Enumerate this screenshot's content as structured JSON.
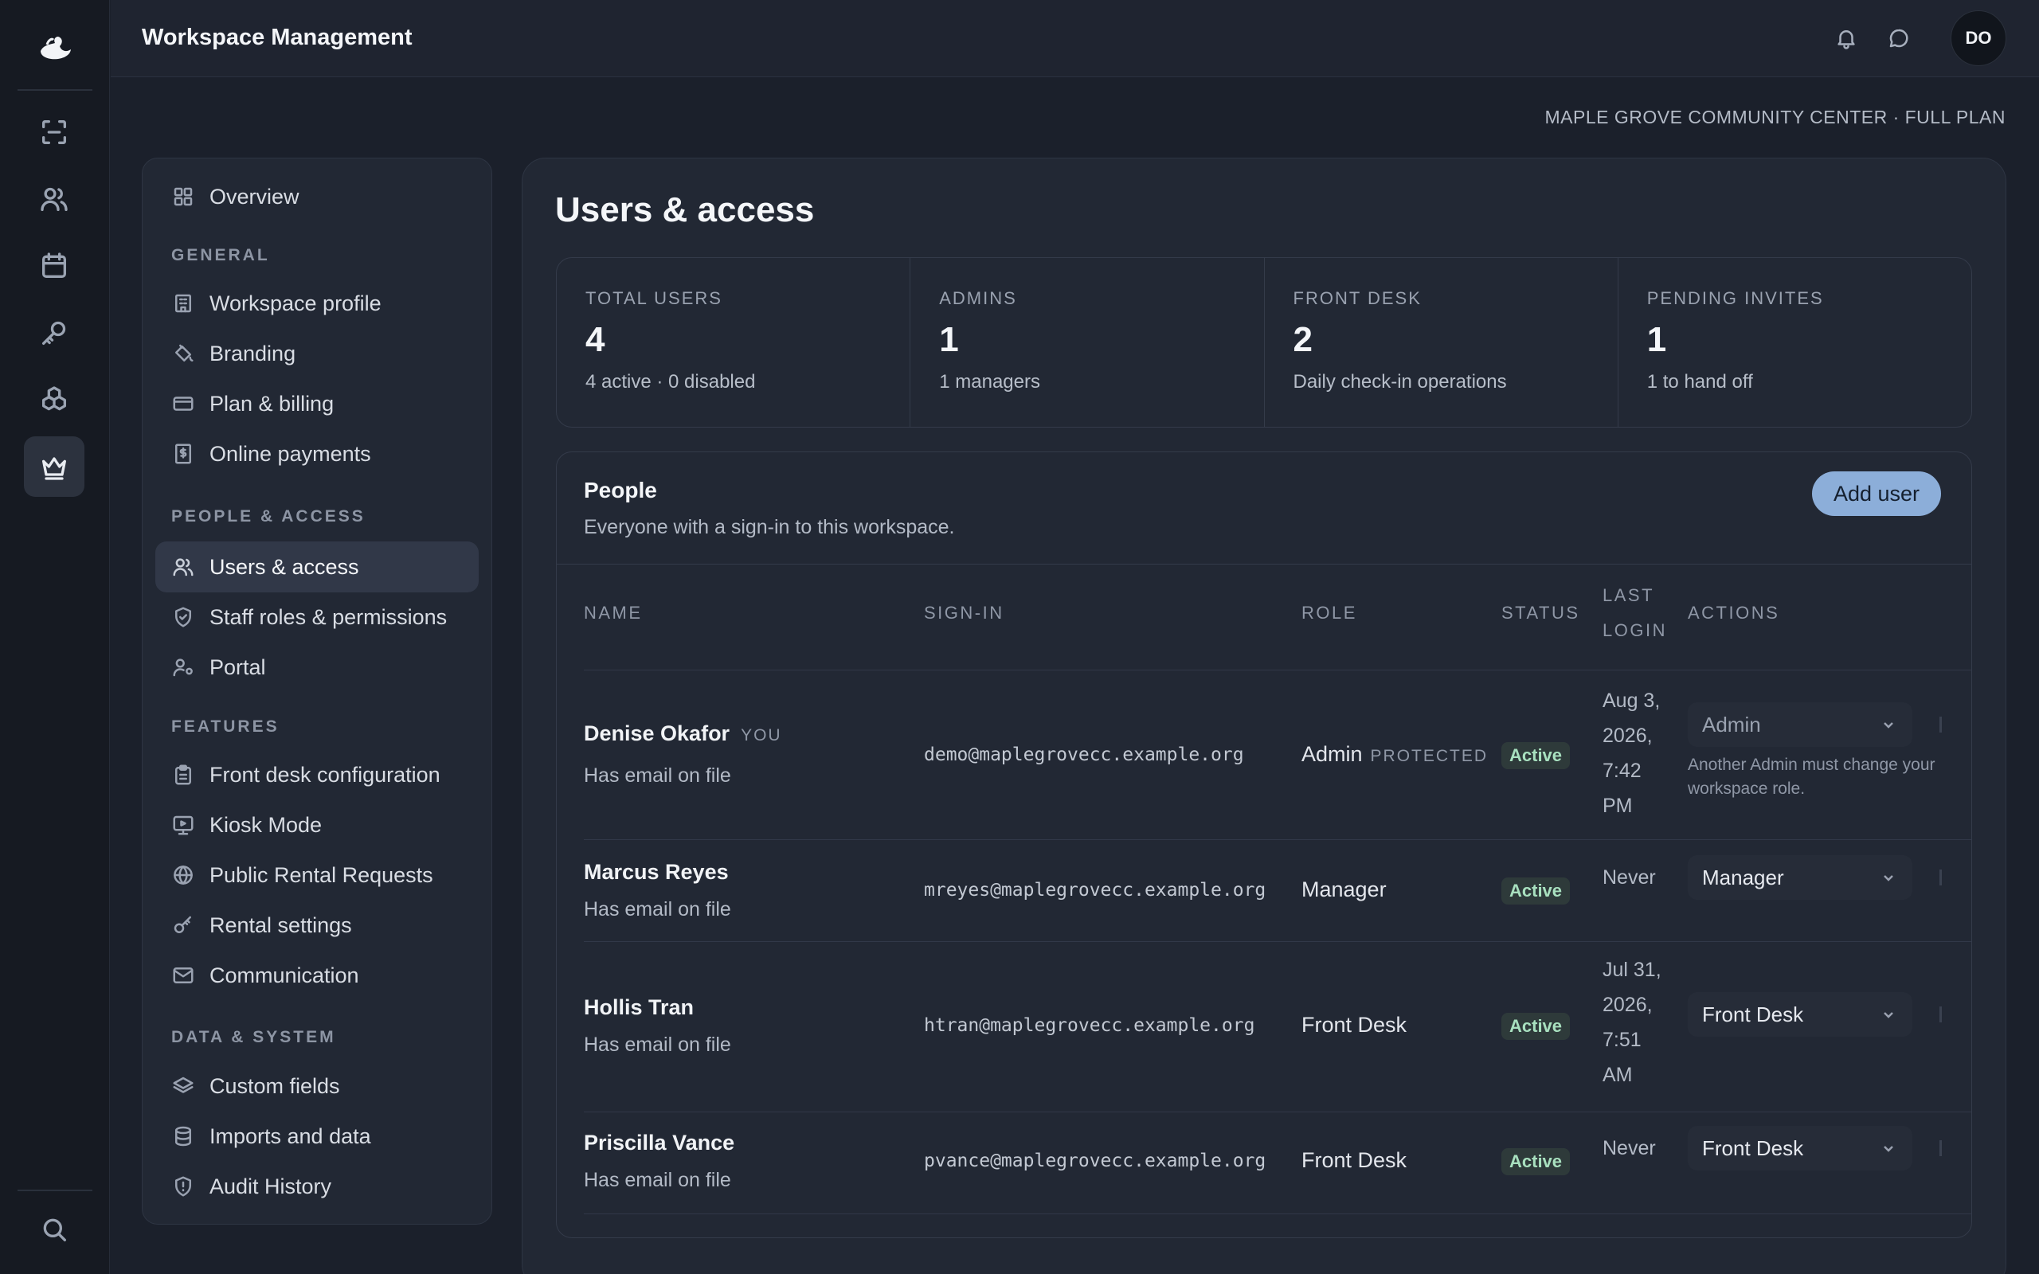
{
  "app": {
    "title": "Workspace Management",
    "avatar_initials": "DO"
  },
  "rail": {
    "items": [
      {
        "icon": "scan-icon"
      },
      {
        "icon": "users-icon"
      },
      {
        "icon": "calendar-icon"
      },
      {
        "icon": "key-icon"
      },
      {
        "icon": "boxes-icon"
      },
      {
        "icon": "crown-icon",
        "active": true
      }
    ],
    "bottom_icon": "search-icon"
  },
  "topbar": {
    "icons": [
      "bell-icon",
      "message-icon"
    ]
  },
  "workspace_line": "MAPLE GROVE COMMUNITY CENTER · FULL PLAN",
  "nav": {
    "overview": "Overview",
    "sections": [
      {
        "heading": "GENERAL",
        "items": [
          "Workspace profile",
          "Branding",
          "Plan & billing",
          "Online payments"
        ]
      },
      {
        "heading": "PEOPLE & ACCESS",
        "items": [
          "Users & access",
          "Staff roles & permissions",
          "Portal"
        ]
      },
      {
        "heading": "FEATURES",
        "items": [
          "Front desk configuration",
          "Kiosk Mode",
          "Public Rental Requests",
          "Rental settings",
          "Communication"
        ]
      },
      {
        "heading": "DATA & SYSTEM",
        "items": [
          "Custom fields",
          "Imports and data",
          "Audit History"
        ]
      }
    ],
    "active_item": "Users & access"
  },
  "page": {
    "title": "Users & access"
  },
  "stats": [
    {
      "label": "TOTAL USERS",
      "value": "4",
      "sub": "4 active · 0 disabled"
    },
    {
      "label": "ADMINS",
      "value": "1",
      "sub": "1 managers"
    },
    {
      "label": "FRONT DESK",
      "value": "2",
      "sub": "Daily check-in operations"
    },
    {
      "label": "PENDING INVITES",
      "value": "1",
      "sub": "1 to hand off"
    }
  ],
  "people": {
    "title": "People",
    "description": "Everyone with a sign-in to this workspace.",
    "add_button": "Add user",
    "columns": {
      "name": "NAME",
      "signin": "SIGN-IN",
      "role": "ROLE",
      "status": "STATUS",
      "last_login_1": "LAST",
      "last_login_2": "LOGIN",
      "actions": "ACTIONS"
    },
    "rows": [
      {
        "name": "Denise Okafor",
        "you_tag": "YOU",
        "sub": "Has email on file",
        "email": "demo@maplegrovecc.example.org",
        "role": "Admin",
        "protected_tag": "PROTECTED",
        "status": "Active",
        "login_lines": [
          "Aug 3,",
          "2026,",
          "7:42",
          "PM"
        ],
        "action_value": "Admin",
        "note_lines": [
          "Another Admin must change your",
          "workspace role."
        ]
      },
      {
        "name": "Marcus Reyes",
        "sub": "Has email on file",
        "email": "mreyes@maplegrovecc.example.org",
        "role": "Manager",
        "status": "Active",
        "login_lines": [
          "Never"
        ],
        "action_value": "Manager"
      },
      {
        "name": "Hollis Tran",
        "sub": "Has email on file",
        "email": "htran@maplegrovecc.example.org",
        "role": "Front Desk",
        "status": "Active",
        "login_lines": [
          "Jul 31,",
          "2026,",
          "7:51",
          "AM"
        ],
        "action_value": "Front Desk"
      },
      {
        "name": "Priscilla Vance",
        "sub": "Has email on file",
        "email": "pvance@maplegrovecc.example.org",
        "role": "Front Desk",
        "status": "Active",
        "login_lines": [
          "Never"
        ],
        "action_value": "Front Desk"
      }
    ]
  }
}
